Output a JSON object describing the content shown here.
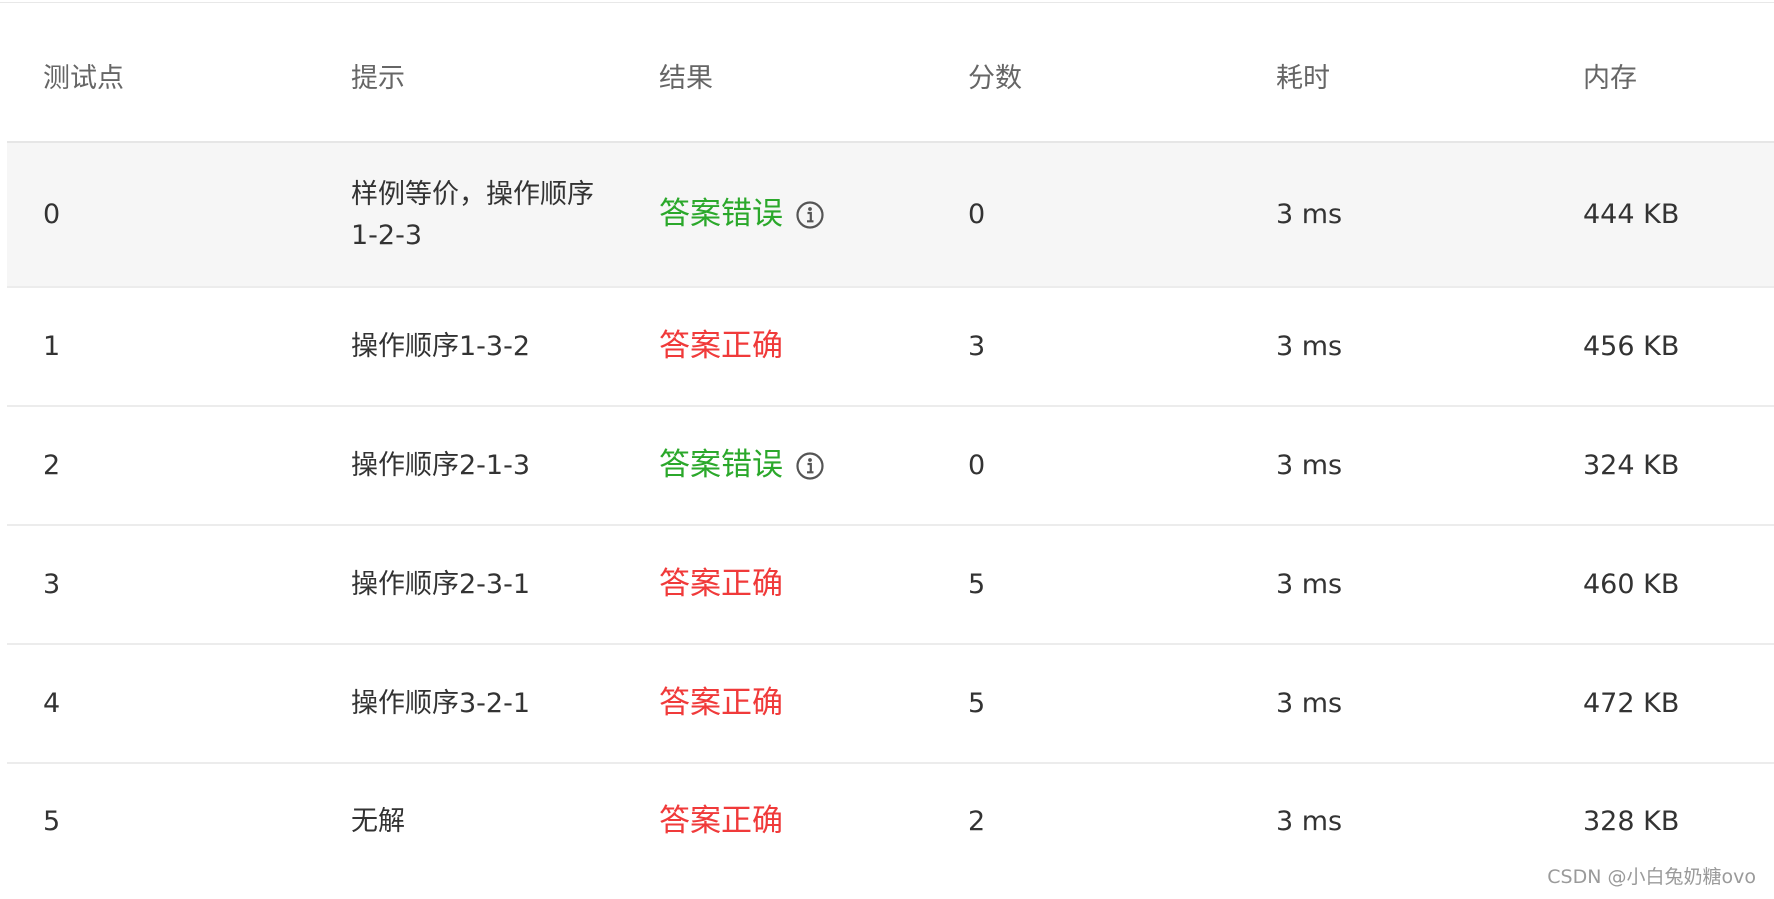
{
  "table": {
    "headers": [
      "测试点",
      "提示",
      "结果",
      "分数",
      "耗时",
      "内存"
    ],
    "rows": [
      {
        "id": "0",
        "hint": "样例等价，操作顺序1-2-3",
        "result": "答案错误",
        "result_status": "wrong",
        "score": "0",
        "time": "3 ms",
        "memory": "444 KB",
        "info_icon": "info-circle-icon"
      },
      {
        "id": "1",
        "hint": "操作顺序1-3-2",
        "result": "答案正确",
        "result_status": "correct",
        "score": "3",
        "time": "3 ms",
        "memory": "456 KB"
      },
      {
        "id": "2",
        "hint": "操作顺序2-1-3",
        "result": "答案错误",
        "result_status": "wrong",
        "score": "0",
        "time": "3 ms",
        "memory": "324 KB",
        "info_icon": "info-circle-icon"
      },
      {
        "id": "3",
        "hint": "操作顺序2-3-1",
        "result": "答案正确",
        "result_status": "correct",
        "score": "5",
        "time": "3 ms",
        "memory": "460 KB"
      },
      {
        "id": "4",
        "hint": "操作顺序3-2-1",
        "result": "答案正确",
        "result_status": "correct",
        "score": "5",
        "time": "3 ms",
        "memory": "472 KB"
      },
      {
        "id": "5",
        "hint": "无解",
        "result": "答案正确",
        "result_status": "correct",
        "score": "2",
        "time": "3 ms",
        "memory": "328 KB"
      }
    ]
  },
  "colors": {
    "wrong": "#2ba82b",
    "correct": "#f03a3a",
    "header_text": "#666666",
    "body_text": "#333333",
    "shaded_row": "#f6f6f6"
  },
  "watermark": "CSDN @小白兔奶糖ovo"
}
